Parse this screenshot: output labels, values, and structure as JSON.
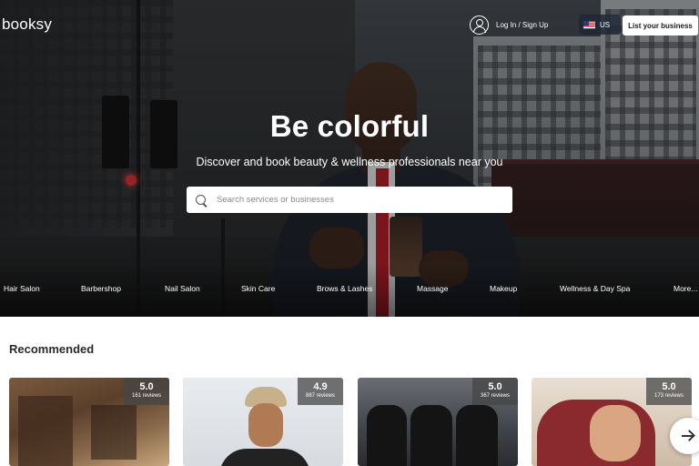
{
  "header": {
    "logo": "booksy",
    "login_label": "Log In / Sign Up",
    "language": "US",
    "list_business_label": "List your business"
  },
  "hero": {
    "headline": "Be colorful",
    "subline": "Discover and book beauty & wellness professionals near you"
  },
  "search": {
    "placeholder": "Search services or businesses",
    "value": ""
  },
  "categories": [
    "Hair Salon",
    "Barbershop",
    "Nail Salon",
    "Skin Care",
    "Brows & Lashes",
    "Massage",
    "Makeup",
    "Wellness & Day Spa",
    "More..."
  ],
  "recommended": {
    "title": "Recommended",
    "cards": [
      {
        "score": "5.0",
        "reviews": "161 reviews"
      },
      {
        "score": "4.9",
        "reviews": "887 reviews"
      },
      {
        "score": "5.0",
        "reviews": "367 reviews"
      },
      {
        "score": "5.0",
        "reviews": "173 reviews"
      }
    ]
  },
  "icons": {
    "user": "user-circle-icon",
    "flag": "us-flag-icon",
    "search": "search-icon",
    "next": "arrow-right-icon"
  },
  "colors": {
    "brand_white": "#ffffff",
    "hero_overlay": "#000000",
    "rating_badge": "#464646"
  }
}
